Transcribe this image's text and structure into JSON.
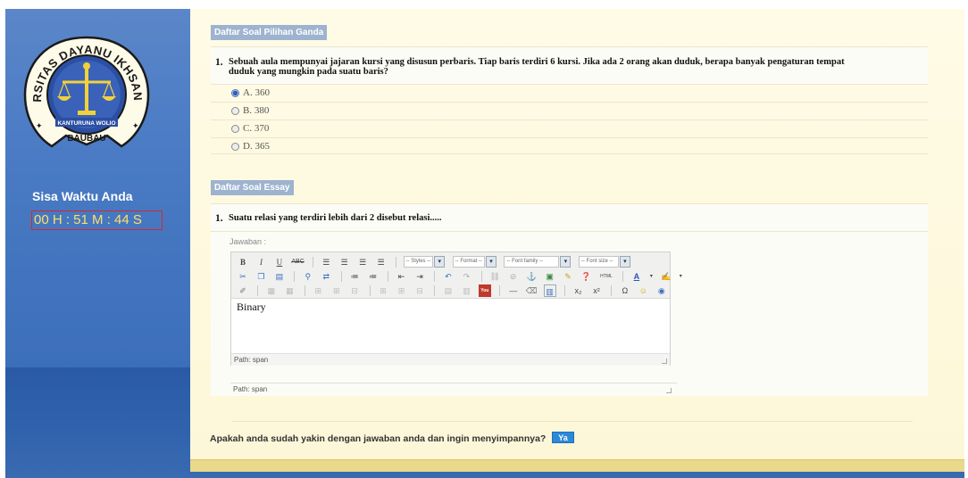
{
  "sidebar": {
    "logo": {
      "ring_text": "UNIVERSITAS DAYANU IKHSANUDDIN",
      "motto": "KANTURUNA WOLIO",
      "city": "BAUBAU"
    },
    "timer_label": "Sisa Waktu Anda",
    "timer_value": "00 H : 51 M : 44 S"
  },
  "multiple_choice": {
    "header": "Daftar Soal Pilihan Ganda",
    "question_number": "1.",
    "question_line1": "Sebuah aula mempunyai jajaran kursi yang disusun perbaris. Tiap baris terdiri 6 kursi. Jika ada 2 orang akan duduk, berapa banyak pengaturan tempat",
    "question_line2": "duduk yang mungkin pada suatu baris?",
    "options": [
      {
        "label": "A. 360",
        "selected": true
      },
      {
        "label": "B. 380",
        "selected": false
      },
      {
        "label": "C. 370",
        "selected": false
      },
      {
        "label": "D. 365",
        "selected": false
      }
    ]
  },
  "essay": {
    "header": "Daftar Soal Essay",
    "question_number": "1.",
    "question": "Suatu relasi yang terdiri lebih dari 2 disebut relasi.....",
    "answer_label": "Jawaban :",
    "editor": {
      "selects": {
        "styles": "-- Styles --",
        "format": "-- Format --",
        "font_family": "-- Font family --",
        "font_size": "-- Font size --"
      },
      "content": "Binary",
      "inner_path": "Path: span",
      "outer_path": "Path: span"
    }
  },
  "confirm": {
    "question": "Apakah anda sudah yakin dengan jawaban anda dan ingin menyimpannya?",
    "button": "Ya"
  },
  "colors": {
    "sidebar_blue": "#4a7bc4",
    "panel_cream": "#fffbe6",
    "section_header": "#9eb3cf",
    "timer_text": "#ffe066",
    "timer_border": "#d22b2b",
    "button_blue": "#2d88d8"
  }
}
